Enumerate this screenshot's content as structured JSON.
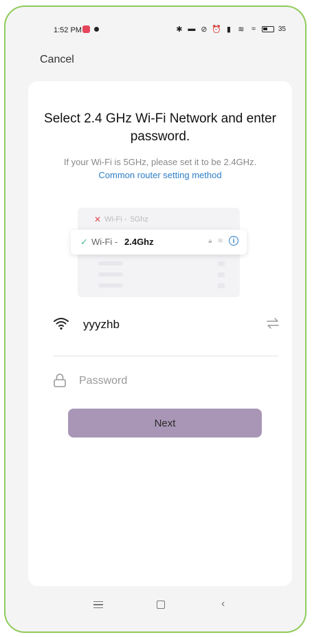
{
  "status_bar": {
    "time": "1:52 PM",
    "battery": "35"
  },
  "header": {
    "cancel_label": "Cancel"
  },
  "main": {
    "title": "Select 2.4 GHz Wi-Fi Network and enter password.",
    "hint_text": "If your Wi-Fi is 5GHz, please set it to be 2.4GHz. ",
    "hint_link": "Common router setting method",
    "illustration": {
      "row_5ghz_prefix": "Wi-Fi - ",
      "row_5ghz_band": "5Ghz",
      "row_24ghz_prefix": "Wi-Fi - ",
      "row_24ghz_band": "2.4Ghz"
    },
    "wifi_name": "yyyzhb",
    "password_placeholder": "Password",
    "next_label": "Next"
  },
  "colors": {
    "accent_link": "#2d7ec8",
    "button_bg": "#a996b6",
    "frame_border": "#8fcb5a"
  }
}
